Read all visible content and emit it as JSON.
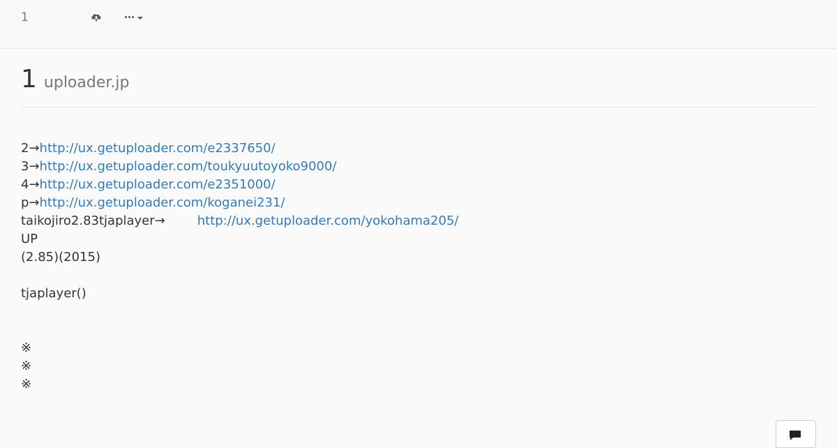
{
  "navbar": {
    "brand": "1",
    "upload_icon": "cloud-upload-icon",
    "more_icon": "ellipsis-icon",
    "caret_icon": "caret-down-icon"
  },
  "header": {
    "number": "1",
    "site": "uploader.jp"
  },
  "lines": [
    {
      "prefix": "2→",
      "link": "http://ux.getuploader.com/e2337650/"
    },
    {
      "prefix": "3→",
      "link": "http://ux.getuploader.com/toukyuutoyoko9000/"
    },
    {
      "prefix": "4→",
      "link": "http://ux.getuploader.com/e2351000/"
    },
    {
      "prefix": "p→",
      "link": "http://ux.getuploader.com/koganei231/"
    },
    {
      "prefix": "taikojiro2.83tjaplayer→",
      "link": "http://ux.getuploader.com/yokohama205/"
    }
  ],
  "text_lines": [
    "UP",
    "(2.85)(2015)",
    "",
    "tjaplayer()",
    "",
    "",
    "※",
    "※",
    "※"
  ],
  "comment_button": {
    "icon": "comment-icon"
  },
  "colors": {
    "link": "#337ab7",
    "text": "#333333",
    "muted": "#777777",
    "background": "#fafafa"
  }
}
